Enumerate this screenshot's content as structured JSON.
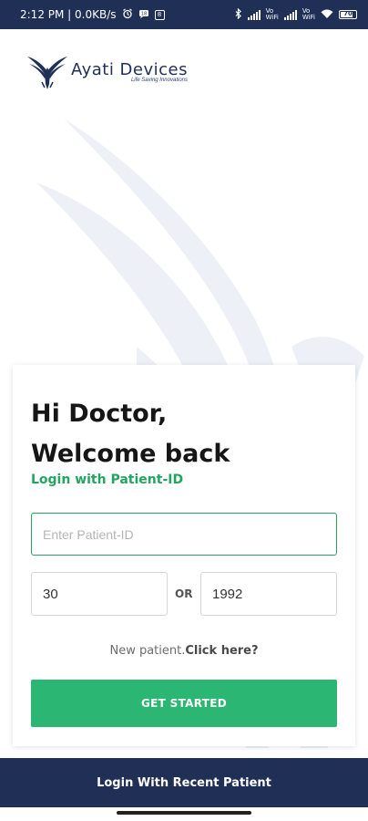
{
  "status_bar": {
    "time_speed": "2:12 PM | 0.0KB/s",
    "battery": "70",
    "icons": [
      "alarm-icon",
      "message-icon",
      "app-badge-icon",
      "bluetooth-icon",
      "signal-icon",
      "volte-icon",
      "signal-icon",
      "volte-icon",
      "wifi-icon",
      "battery-icon"
    ],
    "volte_line1": "Vo",
    "volte_line2": "WiFi"
  },
  "logo": {
    "name": "Ayati Devices",
    "tagline": "Life Saving Innovations",
    "icon": "eagle-logo-icon"
  },
  "card": {
    "greeting_line1": "Hi Doctor,",
    "greeting_line2": "Welcome back",
    "subtitle": "Login with Patient-ID",
    "patient_id_placeholder": "Enter Patient-ID",
    "age_value": "30",
    "or_label": "OR",
    "year_value": "1992",
    "new_patient_text": "New patient.",
    "click_here": "Click here?",
    "get_started": "GET STARTED"
  },
  "bottom_bar": {
    "label": "Login With Recent Patient"
  },
  "colors": {
    "primary_navy": "#1f2f56",
    "accent_green": "#2bb673",
    "subtitle_green": "#23a560"
  }
}
